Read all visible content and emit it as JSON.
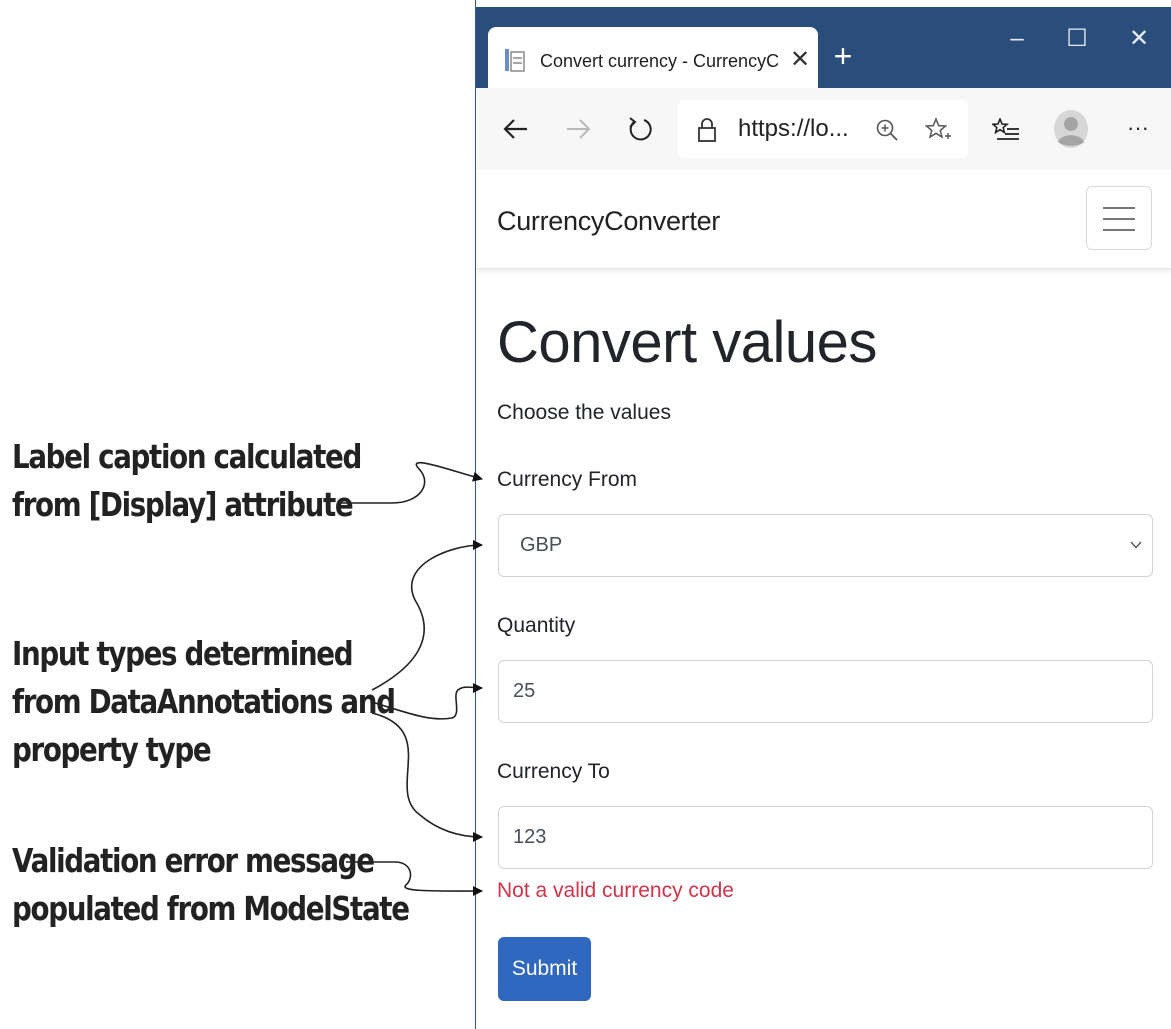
{
  "annotations": {
    "display_attribute": [
      "Label caption calculated",
      "from [Display] attribute"
    ],
    "input_types": [
      "Input types determined",
      "from DataAnnotations and",
      "property type"
    ],
    "validation": [
      "Validation error message",
      "populated from ModelState"
    ]
  },
  "browser": {
    "tab_title": "Convert currency - CurrencyConverter",
    "tab_close": "✕",
    "new_tab": "+",
    "window_controls": {
      "minimize": "–",
      "maximize": "☐",
      "close": "✕"
    },
    "url": "https://lo...",
    "more": "···",
    "icons": [
      "page-icon",
      "back-arrow-icon",
      "forward-arrow-icon",
      "refresh-icon",
      "lock-icon",
      "zoom-icon",
      "favorite-star-icon",
      "favorites-list-icon",
      "avatar",
      "more-icon"
    ]
  },
  "page": {
    "brand": "CurrencyConverter",
    "heading": "Convert values",
    "lead": "Choose the values",
    "form": {
      "currency_from_label": "Currency From",
      "currency_from_value": "GBP",
      "quantity_label": "Quantity",
      "quantity_value": "25",
      "currency_to_label": "Currency To",
      "currency_to_value": "123",
      "error_message": "Not a valid currency code",
      "submit_label": "Submit"
    }
  },
  "colors": {
    "titlebar": "#2a4d7c",
    "error": "#d0344a",
    "submit": "#3068bf"
  }
}
